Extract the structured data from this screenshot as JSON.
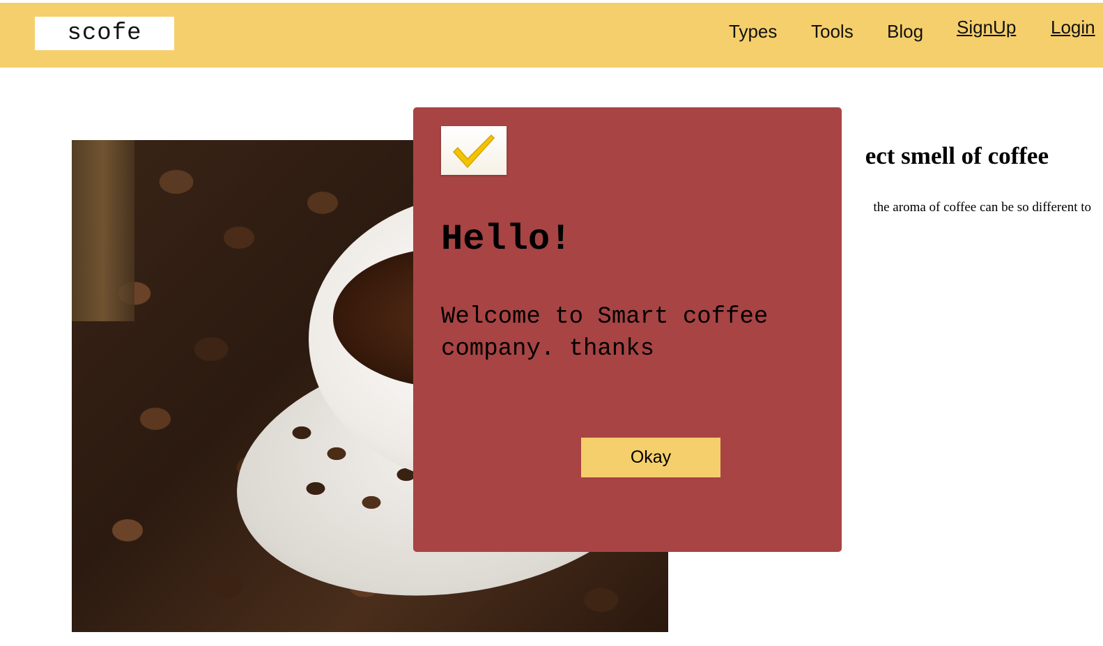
{
  "header": {
    "logo_text": "scofe",
    "nav": {
      "types": "Types",
      "tools": "Tools",
      "blog": "Blog",
      "signup": "SignUp",
      "login": "Login"
    }
  },
  "main": {
    "heading_visible": "ect smell of coffee",
    "body_visible": "the aroma of coffee can be so different to"
  },
  "modal": {
    "icon": "check-icon",
    "title": "Hello!",
    "message": "Welcome to Smart coffee company. thanks",
    "button_label": "Okay"
  },
  "colors": {
    "header_bg": "#f5cf6c",
    "modal_bg": "#a84444",
    "button_bg": "#f5cf6c",
    "check_color": "#f3c300"
  }
}
